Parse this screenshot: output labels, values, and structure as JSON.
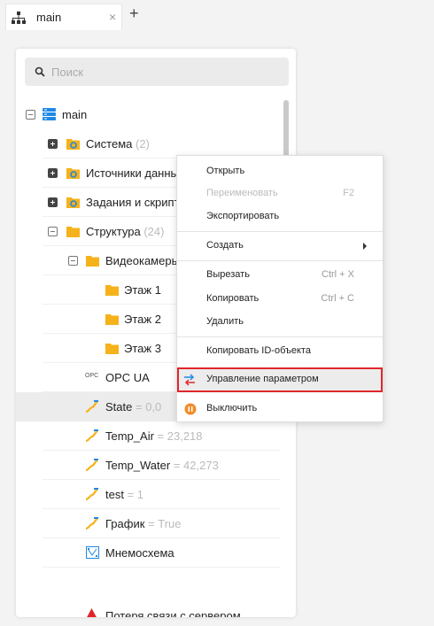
{
  "tab": {
    "label": "main",
    "close_glyph": "×",
    "add_glyph": "+",
    "icon": "hierarchy-icon"
  },
  "search": {
    "placeholder": "Поиск",
    "value": ""
  },
  "tree": {
    "root": {
      "label": "main"
    },
    "items": [
      {
        "name": "Система",
        "count": "(2)"
      },
      {
        "name": "Источники данны",
        "count": ""
      },
      {
        "name": "Задания и скрипт",
        "count": ""
      },
      {
        "name": "Структура",
        "count": "(24)"
      },
      {
        "name": "Видеокамеры",
        "count": ""
      },
      {
        "name": "Этаж 1",
        "count": ""
      },
      {
        "name": "Этаж 2",
        "count": ""
      },
      {
        "name": "Этаж 3",
        "count": ""
      },
      {
        "name": "OPC UA",
        "count": "",
        "prefix": "OPC"
      },
      {
        "name": "State",
        "count": "= 0,0"
      },
      {
        "name": "Temp_Air",
        "count": "= 23,218"
      },
      {
        "name": "Temp_Water",
        "count": "= 42,273"
      },
      {
        "name": "test",
        "count": "= 1"
      },
      {
        "name": "График",
        "count": "= True"
      },
      {
        "name": "Мнемосхема",
        "count": ""
      },
      {
        "name": "Потеря связи с сервером",
        "count": ""
      }
    ]
  },
  "menu": {
    "open": "Открыть",
    "rename": "Переименовать",
    "rename_shortcut": "F2",
    "export": "Экспортировать",
    "create": "Создать",
    "cut": "Вырезать",
    "cut_shortcut": "Ctrl + X",
    "copy": "Копировать",
    "copy_shortcut": "Ctrl + C",
    "delete": "Удалить",
    "copy_id": "Копировать ID-объекта",
    "manage_param": "Управление параметром",
    "disable": "Выключить"
  },
  "colors": {
    "folder": "#f5b21a",
    "highlight_border": "#e0262b",
    "db_blue": "#1e88e5",
    "param_icon": "#f5b21a"
  }
}
